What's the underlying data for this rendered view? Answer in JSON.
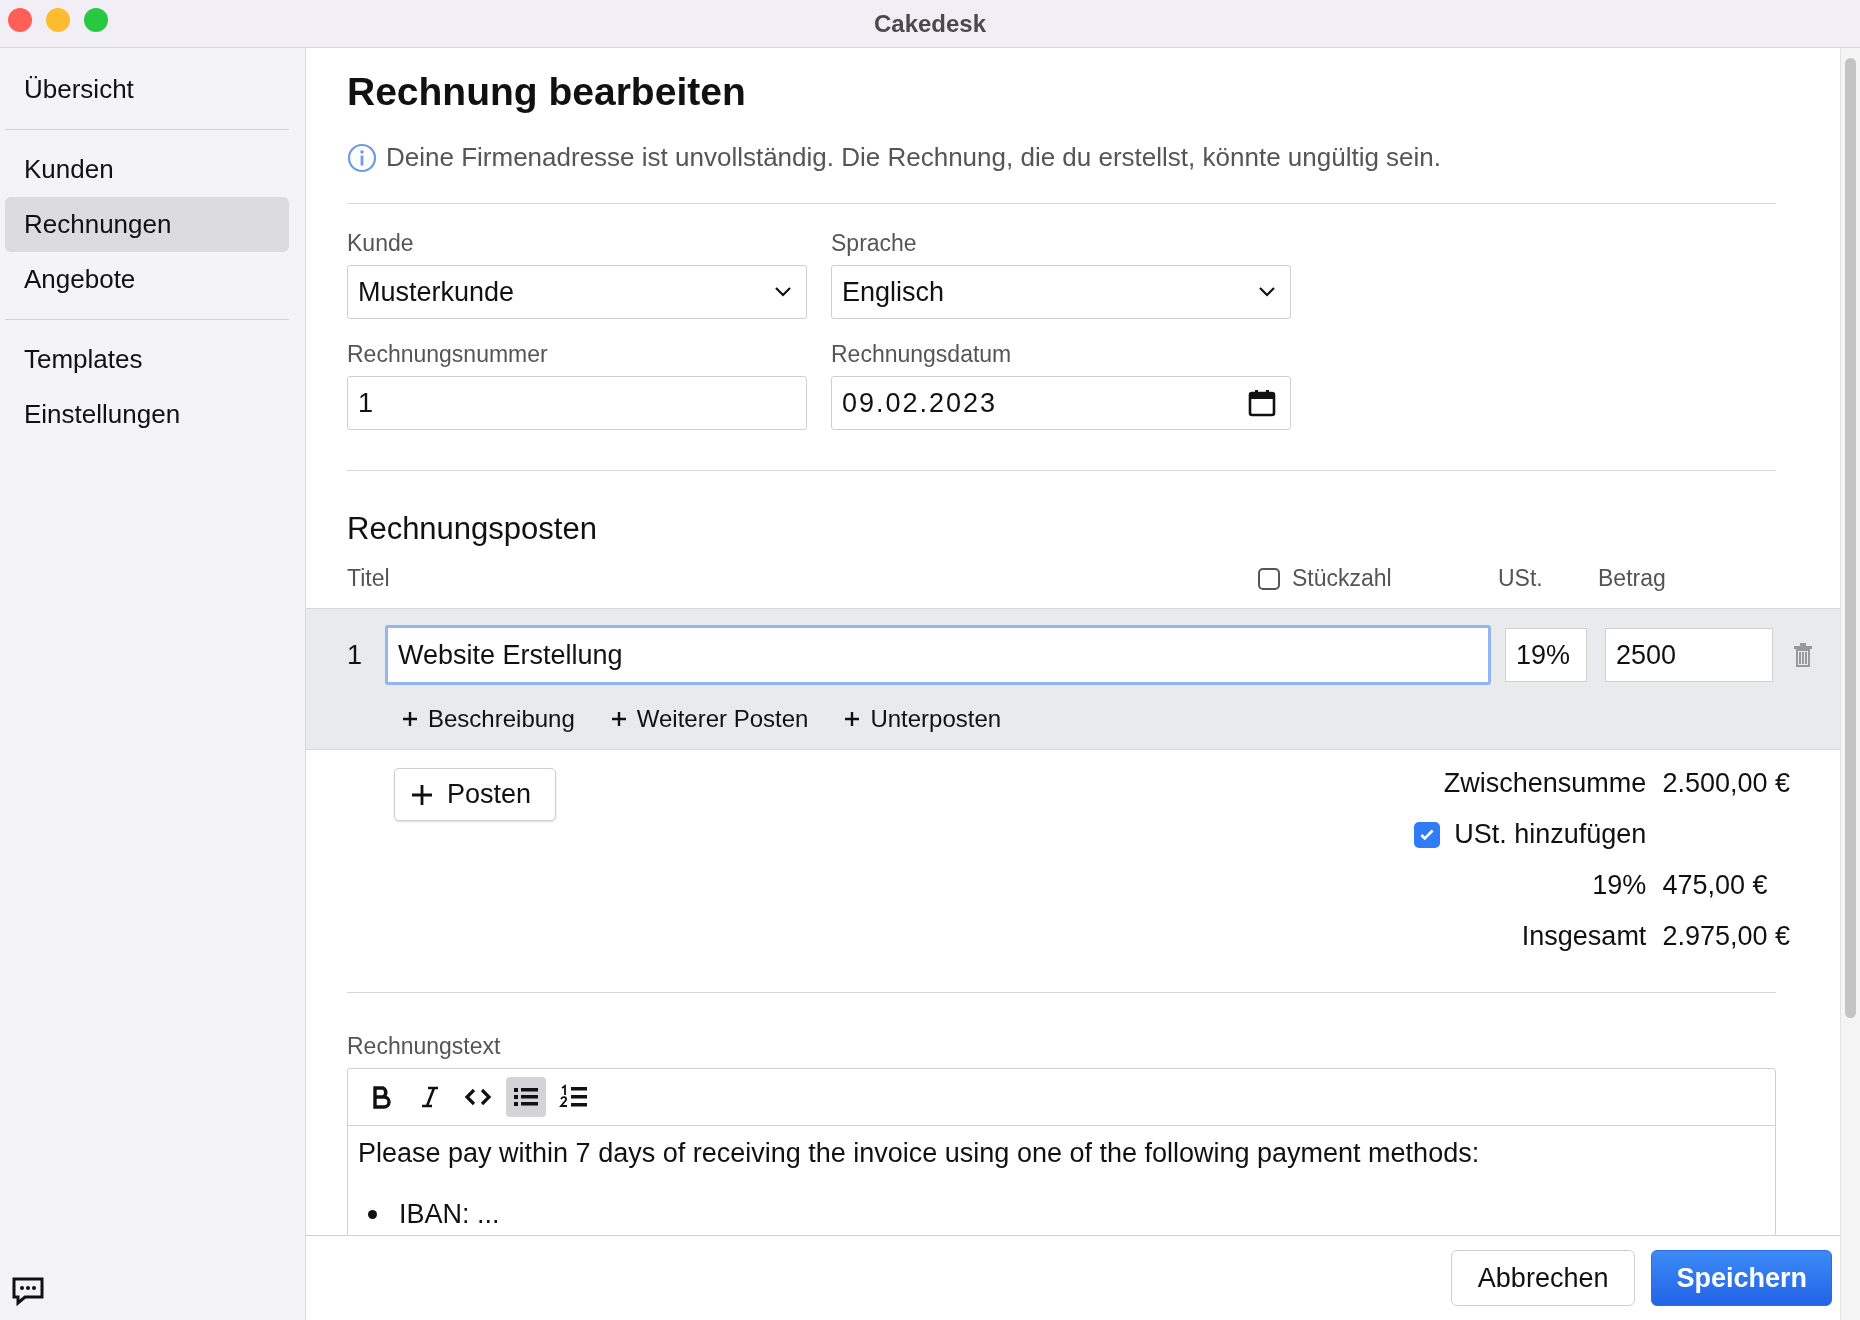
{
  "window": {
    "title": "Cakedesk"
  },
  "sidebar": {
    "groups": [
      {
        "items": [
          {
            "label": "Übersicht",
            "selected": false
          }
        ]
      },
      {
        "items": [
          {
            "label": "Kunden",
            "selected": false
          },
          {
            "label": "Rechnungen",
            "selected": true
          },
          {
            "label": "Angebote",
            "selected": false
          }
        ]
      },
      {
        "items": [
          {
            "label": "Templates",
            "selected": false
          },
          {
            "label": "Einstellungen",
            "selected": false
          }
        ]
      }
    ]
  },
  "page": {
    "heading": "Rechnung bearbeiten",
    "notice": "Deine Firmenadresse ist unvollständig. Die Rechnung, die du erstellst, könnte ungültig sein.",
    "fields": [
      {
        "kind": "select",
        "label": "Kunde",
        "value": "Musterkunde"
      },
      {
        "kind": "select",
        "label": "Sprache",
        "value": "Englisch"
      },
      {
        "kind": "text",
        "label": "Rechnungsnummer",
        "value": "1"
      },
      {
        "kind": "date",
        "label": "Rechnungsdatum",
        "value": "09.02.2023"
      }
    ],
    "items_section": {
      "title": "Rechnungsposten",
      "columns": {
        "title": "Titel",
        "quantity": {
          "label": "Stückzahl",
          "checked": false
        },
        "vat": "USt.",
        "amount": "Betrag"
      },
      "rows": [
        {
          "number": "1",
          "title": "Website Erstellung",
          "vat": "19%",
          "amount": "2500",
          "focused": true,
          "actions": [
            "Beschreibung",
            "Weiterer Posten",
            "Unterposten"
          ]
        }
      ],
      "add_button": "Posten"
    },
    "totals": {
      "subtotal_label": "Zwischensumme",
      "subtotal": "2.500,00 €",
      "vat_toggle": {
        "label": "USt. hinzufügen",
        "checked": true
      },
      "vat_rate": "19%",
      "vat_amount": "475,00 €",
      "total_label": "Insgesamt",
      "total": "2.975,00 €"
    },
    "text_editor": {
      "label": "Rechnungstext",
      "toolbar": [
        {
          "kind": "bold",
          "selected": false
        },
        {
          "kind": "italic",
          "selected": false
        },
        {
          "kind": "code",
          "selected": false
        },
        {
          "kind": "bullet_list",
          "selected": true
        },
        {
          "kind": "ordered_list",
          "selected": false
        }
      ],
      "paragraph": "Please pay within 7 days of receiving the invoice using one of the following payment methods:",
      "bullets": [
        "IBAN: ..."
      ]
    }
  },
  "footer": {
    "buttons": [
      {
        "kind": "secondary",
        "label": "Abbrechen"
      },
      {
        "kind": "primary",
        "label": "Speichern"
      }
    ]
  }
}
